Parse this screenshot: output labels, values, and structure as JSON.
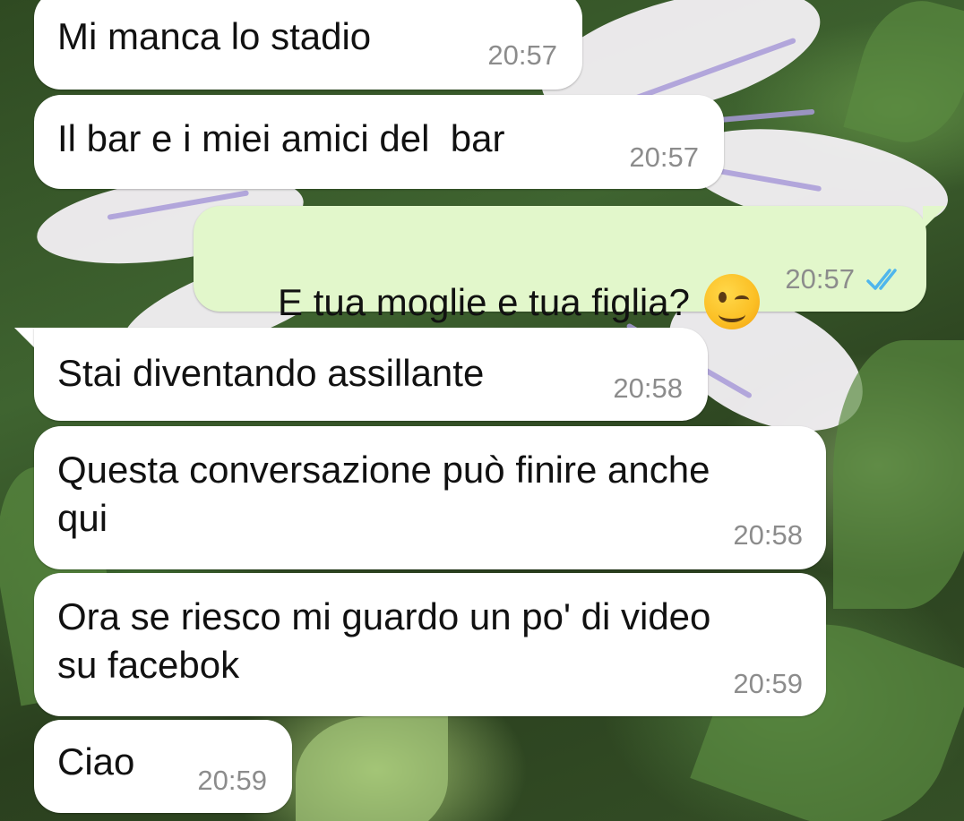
{
  "colors": {
    "incoming_bubble": "#ffffff",
    "outgoing_bubble": "#e2f7cb",
    "timestamp": "#8c8c8c",
    "read_ticks": "#4fb6ec"
  },
  "messages": [
    {
      "direction": "incoming",
      "text": "Mi manca lo stadio",
      "time": "20:57"
    },
    {
      "direction": "incoming",
      "text": "Il bar e i miei amici del  bar",
      "time": "20:57"
    },
    {
      "direction": "outgoing",
      "text": "E tua moglie e tua figlia?",
      "emoji": "winking-face-icon",
      "time": "20:57",
      "status": "read-double-check-icon"
    },
    {
      "direction": "incoming",
      "text": "Stai diventando assillante",
      "time": "20:58"
    },
    {
      "direction": "incoming",
      "text": "Questa conversazione può finire anche\nqui",
      "time": "20:58"
    },
    {
      "direction": "incoming",
      "text": "Ora se riesco mi guardo un po' di video\nsu facebok",
      "time": "20:59"
    },
    {
      "direction": "incoming",
      "text": "Ciao",
      "time": "20:59"
    }
  ]
}
